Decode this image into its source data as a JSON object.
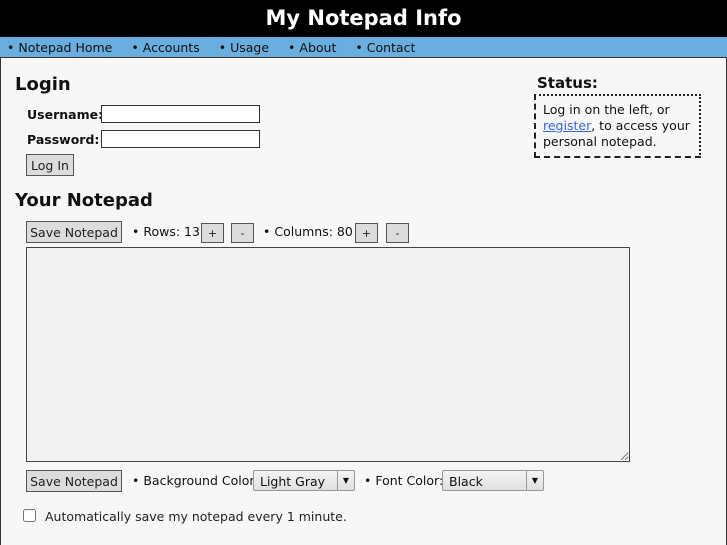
{
  "header": {
    "title": "My Notepad Info"
  },
  "nav": [
    "Notepad Home",
    "Accounts",
    "Usage",
    "About",
    "Contact"
  ],
  "login": {
    "heading": "Login",
    "username_label": "Username:",
    "password_label": "Password:",
    "username_value": "",
    "password_value": "",
    "button": "Log In"
  },
  "status": {
    "heading": "Status:",
    "text_before": "Log in on the left, or ",
    "link": "register",
    "text_after": ", to access your personal notepad."
  },
  "notepad": {
    "heading": "Your Notepad",
    "save_label": "Save Notepad",
    "rows_label": "• Rows: 13",
    "cols_label": "• Columns: 80",
    "plus": "+",
    "minus": "-",
    "content": "",
    "bg_label": "• Background Color:",
    "bg_value": "Light Gray",
    "font_label": "• Font Color:",
    "font_value": "Black",
    "autosave_label": "Automatically save my notepad every 1 minute.",
    "autosave_checked": false
  }
}
